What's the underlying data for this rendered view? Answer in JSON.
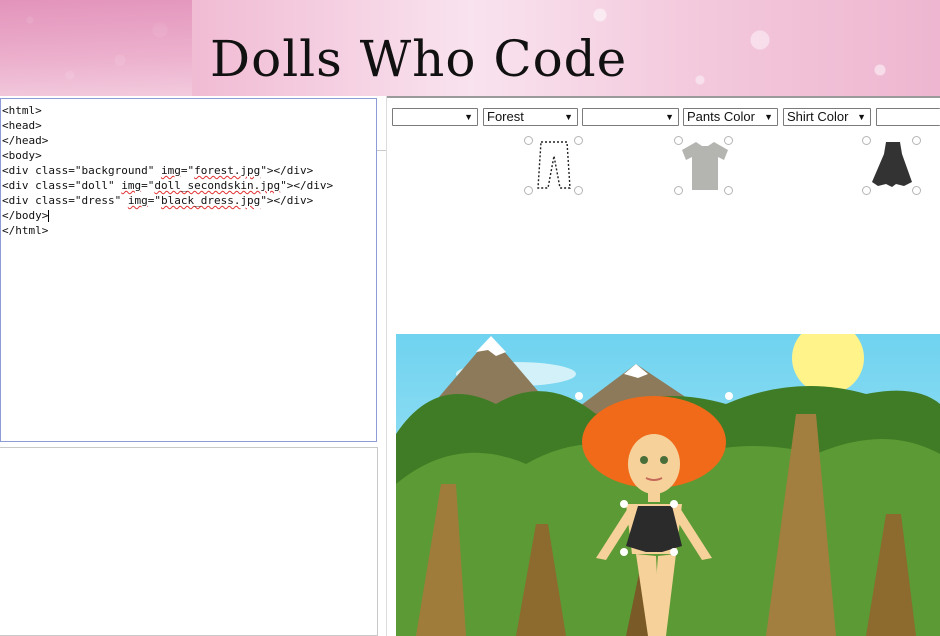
{
  "header": {
    "title": "Dolls Who Code"
  },
  "editor": {
    "lines": [
      "<html>",
      "<head>",
      "</head>",
      "<body>",
      "<div class=\"background\" img=\"forest.jpg\"></div>",
      "<div class=\"doll\" img=\"doll_secondskin.jpg\"></div>",
      "<div class=\"dress\" img=\"black_dress.jpg\"></div>",
      "</body>",
      "</html>"
    ]
  },
  "toolbar": {
    "dropdowns": [
      {
        "value": ""
      },
      {
        "value": "Forest"
      },
      {
        "value": ""
      },
      {
        "value": "Pants Color"
      },
      {
        "value": "Shirt Color"
      },
      {
        "value": ""
      }
    ],
    "arrow_glyph": "▼"
  },
  "thumbnails": [
    {
      "name": "pants",
      "color": "#ffffff"
    },
    {
      "name": "shirt",
      "color": "#b4b4b0"
    },
    {
      "name": "dress",
      "color": "#333333"
    }
  ],
  "scene": {
    "background": "forest.jpg",
    "doll": "doll_secondskin.jpg",
    "dress": "black_dress.jpg",
    "colors": {
      "sky": "#6fd3f0",
      "sun": "#fff38a",
      "hair": "#f06a1a",
      "tree": "#7a5a26",
      "foliage": "#4d8a2c",
      "dress": "#2b2b2b"
    }
  }
}
